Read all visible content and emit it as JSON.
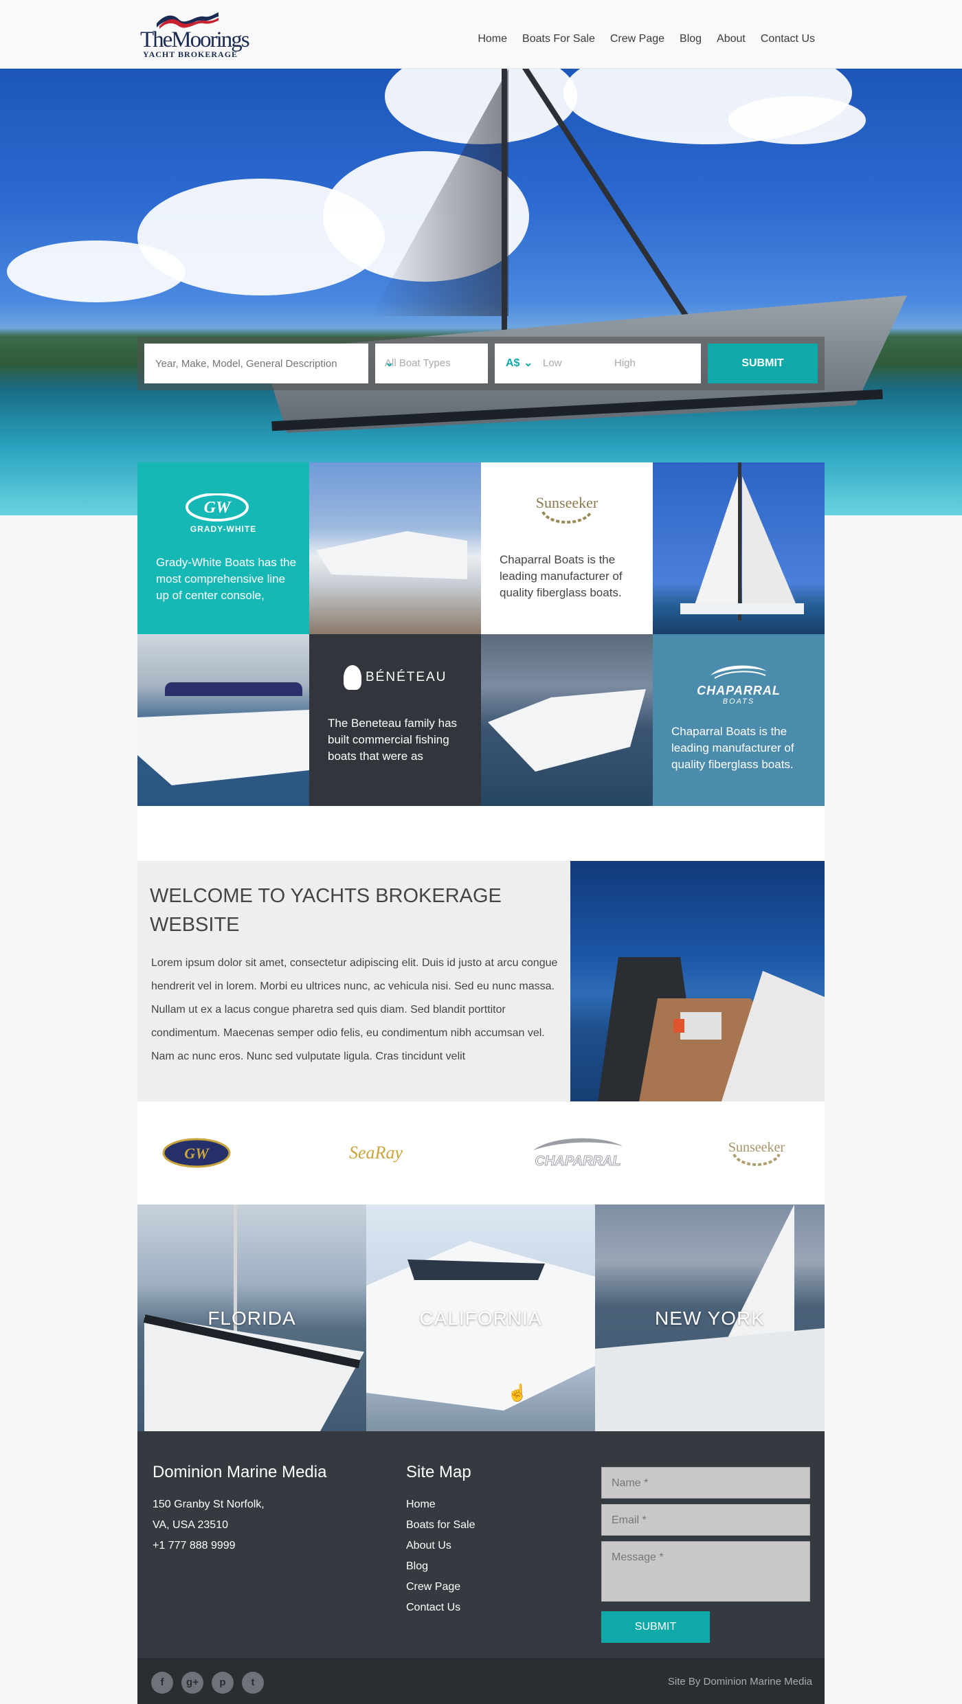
{
  "logo": {
    "brand": "TheMoorings",
    "sub": "YACHT BROKERAGE"
  },
  "nav": [
    "Home",
    "Boats For Sale",
    "Crew Page",
    "Blog",
    "About",
    "Contact Us"
  ],
  "search": {
    "keyword_placeholder": "Year, Make, Model, General Description",
    "type_value": "All Boat Types",
    "currency": "A$",
    "low_placeholder": "Low",
    "high_placeholder": "High",
    "submit_label": "SUBMIT"
  },
  "tiles": {
    "grady": {
      "logo": "GRADY-WHITE",
      "text": "Grady-White Boats has the most comprehensive line up of center console,"
    },
    "sunseeker": {
      "logo": "Sunseeker",
      "text": "Chaparral Boats is the leading manufacturer of quality fiberglass boats."
    },
    "beneteau": {
      "logo": "BÉNÉTEAU",
      "text": "The Beneteau family has built commercial fishing boats that were as"
    },
    "chaparral": {
      "logo": "CHAPARRAL",
      "logo_sub": "BOATS",
      "text": "Chaparral Boats is the leading manufacturer of quality fiberglass boats."
    }
  },
  "welcome": {
    "title": "WELCOME TO YACHTS BROKERAGE WEBSITE",
    "body": "Lorem ipsum dolor sit amet, consectetur adipiscing elit. Duis id justo at arcu congue hendrerit vel in lorem. Morbi eu ultrices nunc, ac vehicula nisi. Sed eu nunc massa. Nullam ut ex a lacus congue pharetra sed quis diam. Sed blandit porttitor condimentum. Maecenas semper odio felis, eu condimentum nibh accumsan vel. Nam ac nunc eros. Nunc sed vulputate ligula. Cras tincidunt velit"
  },
  "brands": [
    "GW",
    "SeaRay",
    "CHAPARRAL",
    "Sunseeker"
  ],
  "locations": [
    "FLORIDA",
    "CALIFORNIA",
    "NEW YORK"
  ],
  "footer": {
    "company": "Dominion Marine Media",
    "address": [
      "150 Granby St Norfolk,",
      "VA, USA 23510",
      "+1 777 888 9999"
    ],
    "sitemap_title": "Site Map",
    "sitemap": [
      "Home",
      "Boats for Sale",
      "About Us",
      "Blog",
      "Crew Page",
      "Contact Us"
    ],
    "name_placeholder": "Name *",
    "email_placeholder": "Email *",
    "message_placeholder": "Message *",
    "submit_label": "SUBMIT",
    "credit": "Site By Dominion Marine Media",
    "social": [
      "f",
      "g+",
      "p",
      "t"
    ]
  },
  "colors": {
    "accent": "#10a9a9",
    "teal_tile": "#15b8b5",
    "dark_tile": "#32363c",
    "blue_tile": "#4b8bab",
    "footer": "#353a41"
  }
}
